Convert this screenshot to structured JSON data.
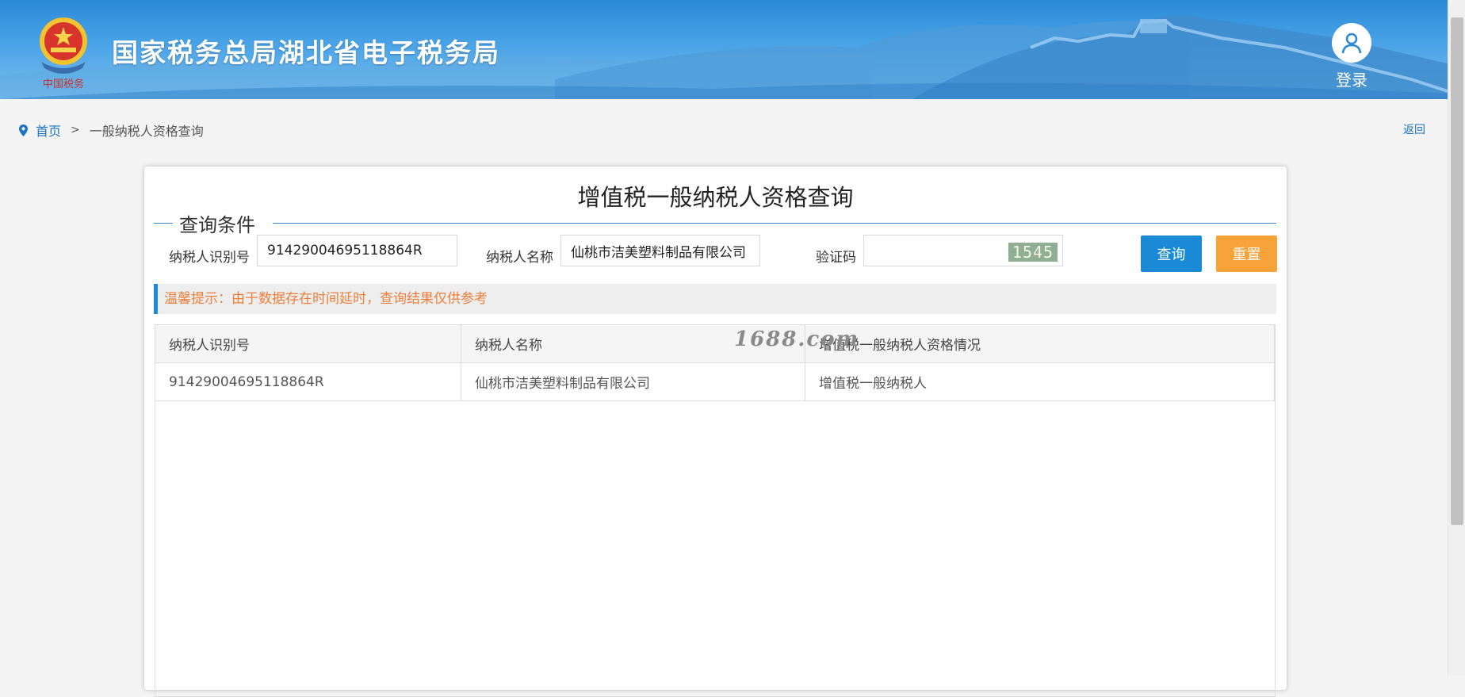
{
  "header": {
    "site_title": "国家税务总局湖北省电子税务局",
    "emblem_caption": "中国税务",
    "login_label": "登录",
    "brand_color": "#2a8ad8"
  },
  "breadcrumb": {
    "icon": "location-pin-icon",
    "home": "首页",
    "separator": ">",
    "current": "一般纳税人资格查询",
    "back": "返回"
  },
  "form": {
    "title": "增值税一般纳税人资格查询",
    "legend": "查询条件",
    "taxpayer_id_label": "纳税人识别号",
    "taxpayer_id_value": "91429004695118864R",
    "taxpayer_name_label": "纳税人名称",
    "taxpayer_name_value": "仙桃市洁美塑料制品有限公司",
    "captcha_label": "验证码",
    "captcha_value": "",
    "captcha_image_text": "1545",
    "query_button": "查询",
    "reset_button": "重置",
    "query_color": "#1a8ad6",
    "reset_color": "#f8a23a"
  },
  "notice": {
    "text": "温馨提示：由于数据存在时间延时，查询结果仅供参考",
    "color": "#ee7e3a"
  },
  "results": {
    "headers": [
      "纳税人识别号",
      "纳税人名称",
      "增值税一般纳税人资格情况"
    ],
    "rows": [
      [
        "91429004695118864R",
        "仙桃市洁美塑料制品有限公司",
        "增值税一般纳税人"
      ]
    ],
    "watermark": "1688.com"
  }
}
